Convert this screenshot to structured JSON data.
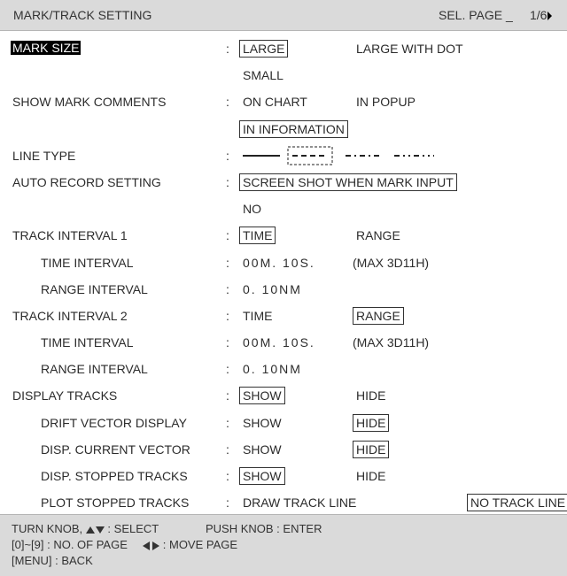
{
  "header": {
    "title": "MARK/TRACK SETTING",
    "sel_page_label": "SEL. PAGE _",
    "page_indicator": "1/6"
  },
  "rows": {
    "mark_size": {
      "label": "MARK SIZE",
      "opt1": "LARGE",
      "opt2": "LARGE WITH DOT",
      "opt3": "SMALL"
    },
    "show_mark_comments": {
      "label": "SHOW MARK COMMENTS",
      "opt1": "ON CHART",
      "opt2": "IN POPUP",
      "opt3": "IN INFORMATION"
    },
    "line_type": {
      "label": "LINE TYPE"
    },
    "auto_record": {
      "label": "AUTO RECORD SETTING",
      "opt1": "SCREEN SHOT WHEN MARK INPUT",
      "opt2": "NO"
    },
    "track_interval_1": {
      "label": "TRACK INTERVAL 1",
      "opt1": "TIME",
      "opt2": "RANGE"
    },
    "time_interval_1": {
      "label": "TIME INTERVAL",
      "value": "00M. 10S.",
      "note": "(MAX 3D11H)"
    },
    "range_interval_1": {
      "label": "RANGE INTERVAL",
      "value": "0. 10NM"
    },
    "track_interval_2": {
      "label": "TRACK INTERVAL 2",
      "opt1": "TIME",
      "opt2": "RANGE"
    },
    "time_interval_2": {
      "label": "TIME INTERVAL",
      "value": "00M. 10S.",
      "note": "(MAX 3D11H)"
    },
    "range_interval_2": {
      "label": "RANGE INTERVAL",
      "value": "0. 10NM"
    },
    "display_tracks": {
      "label": "DISPLAY TRACKS",
      "opt1": "SHOW",
      "opt2": "HIDE"
    },
    "drift_vector": {
      "label": "DRIFT VECTOR DISPLAY",
      "opt1": "SHOW",
      "opt2": "HIDE"
    },
    "disp_current_vector": {
      "label": "DISP. CURRENT VECTOR",
      "opt1": "SHOW",
      "opt2": "HIDE"
    },
    "disp_stopped_tracks": {
      "label": "DISP. STOPPED TRACKS",
      "opt1": "SHOW",
      "opt2": "HIDE"
    },
    "plot_stopped_tracks": {
      "label": "PLOT STOPPED TRACKS",
      "opt1": "DRAW TRACK LINE",
      "opt2": "NO TRACK LINE"
    }
  },
  "colon": ":",
  "footer": {
    "line1_a": "TURN KNOB,",
    "line1_b": ": SELECT",
    "line1_c": "PUSH KNOB : ENTER",
    "line2_a": "[0]~[9] : NO. OF PAGE",
    "line2_b": ": MOVE PAGE",
    "line3": "[MENU] : BACK"
  }
}
